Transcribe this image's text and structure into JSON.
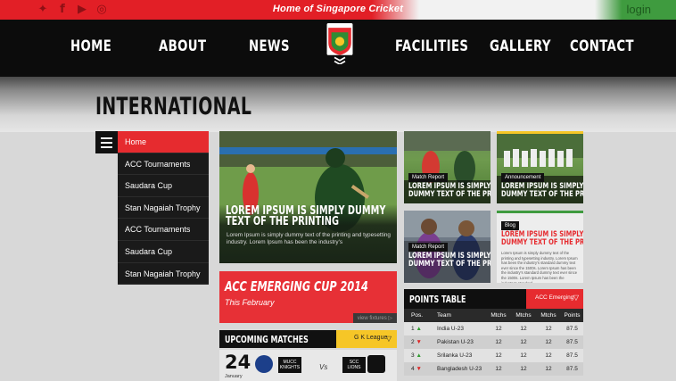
{
  "topbar": {
    "social_icons": [
      "twitter-icon",
      "facebook-icon",
      "youtube-icon",
      "instagram-icon"
    ],
    "tagline": "Home of Singapore Cricket",
    "login": "login"
  },
  "nav": {
    "items": [
      "HOME",
      "ABOUT",
      "NEWS",
      "FACILITIES",
      "GALLERY",
      "CONTACT"
    ],
    "logo_text": "SINGAPORE CRICKET"
  },
  "page": {
    "title": "INTERNATIONAL"
  },
  "sidebar": {
    "items": [
      "Home",
      "ACC Tournaments",
      "Saudara Cup",
      "Stan Nagaiah Trophy",
      "ACC Tournaments",
      "Saudara Cup",
      "Stan Nagaiah Trophy"
    ],
    "active_index": 0
  },
  "feature": {
    "headline": "LOREM IPSUM IS SIMPLY DUMMY TEXT OF THE PRINTING",
    "description": "Lorem Ipsum is simply dummy text of the printing and typesetting industry. Lorem Ipsum has been the industry's"
  },
  "cards": [
    {
      "tag": "Match Report",
      "headline_1": "LOREM IPSUM IS SIMPLY",
      "headline_2": "DUMMY TEXT OF THE PRINTING"
    },
    {
      "tag": "Announcement",
      "headline_1": "LOREM IPSUM IS SIMPLY",
      "headline_2": "DUMMY TEXT OF THE PRINTING"
    },
    {
      "tag": "Match Report",
      "headline_1": "LOREM IPSUM IS SIMPLY",
      "headline_2": "DUMMY TEXT OF THE PRINTING"
    },
    {
      "tag": "Blog",
      "headline_1": "LOREM IPSUM IS SIMPLY",
      "headline_2": "DUMMY TEXT OF THE PRINTING",
      "description": "Lorem Ipsum is simply dummy text of the printing and typesetting industry. Lorem Ipsum has been the industry's standard dummy text ever since the 1500s. Lorem Ipsum has been the industry's standard dummy text ever since the 1500s. Lorem Ipsum has been the industry's standard..."
    }
  ],
  "promo": {
    "title": "ACC EMERGING CUP 2014",
    "subtitle": "This February",
    "more": "view fixtures ▷"
  },
  "upcoming": {
    "title": "UPCOMING MATCHES",
    "league": "G K League",
    "day": "24",
    "month": "January",
    "team_a": "MUCC KNIGHTS",
    "vs": "Vs",
    "team_b": "SCC LIONS"
  },
  "points_table": {
    "title": "POINTS TABLE",
    "filter": "ACC Emerging",
    "columns": [
      "Pos.",
      "Team",
      "Mtchs",
      "Mtchs",
      "Mtchs",
      "Points"
    ],
    "rows": [
      {
        "pos": "1",
        "trend": "up",
        "team": "India U-23",
        "a": "12",
        "b": "12",
        "c": "12",
        "pts": "87.5"
      },
      {
        "pos": "2",
        "trend": "down",
        "team": "Pakistan U-23",
        "a": "12",
        "b": "12",
        "c": "12",
        "pts": "87.5"
      },
      {
        "pos": "3",
        "trend": "up",
        "team": "Srilanka U-23",
        "a": "12",
        "b": "12",
        "c": "12",
        "pts": "87.5"
      },
      {
        "pos": "4",
        "trend": "down",
        "team": "Bangladesh U-23",
        "a": "12",
        "b": "12",
        "c": "12",
        "pts": "87.5"
      }
    ]
  },
  "colors": {
    "brand_red": "#e62b2f",
    "brand_green": "#3f9b3f",
    "accent_yellow": "#f6c627",
    "dark": "#0c0c0c"
  }
}
